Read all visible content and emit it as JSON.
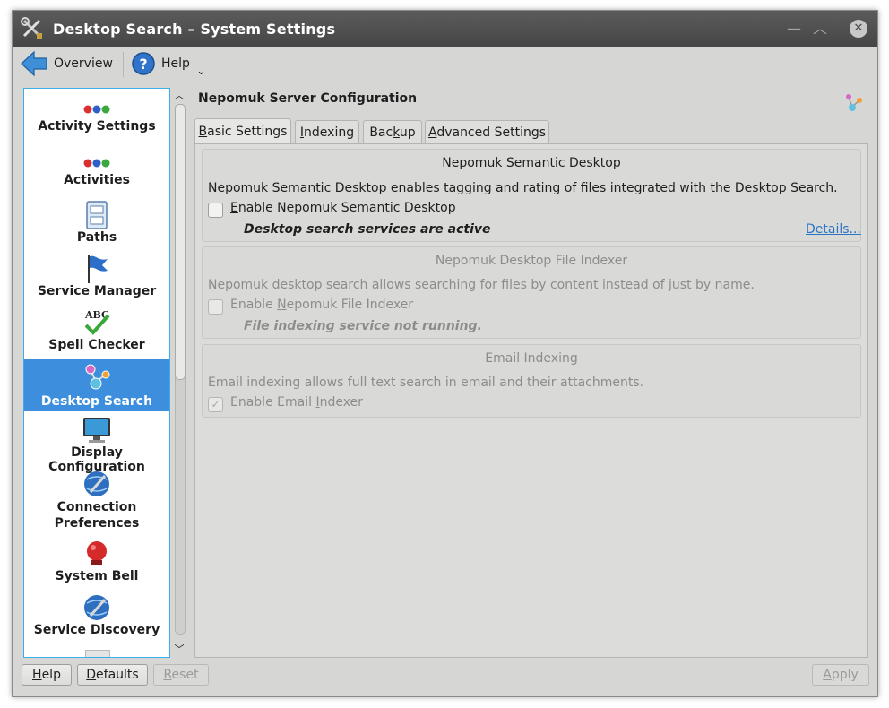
{
  "window": {
    "title": "Desktop Search – System Settings"
  },
  "toolbar": {
    "overview_label": "Overview",
    "help_label": "Help",
    "menu_arrow": "⌄"
  },
  "sidebar": {
    "items": [
      {
        "label": "Activity Settings",
        "icon": "three-dots-icon"
      },
      {
        "label": "Activities",
        "icon": "three-dots-icon"
      },
      {
        "label": "Paths",
        "icon": "drawer-icon"
      },
      {
        "label": "Service Manager",
        "icon": "flag-icon"
      },
      {
        "label": "Spell Checker",
        "icon": "abc-check-icon"
      },
      {
        "label": "Desktop Search",
        "icon": "molecule-icon",
        "selected": true
      },
      {
        "label": "Display Configuration",
        "icon": "monitor-icon"
      },
      {
        "label_line1": "Connection",
        "label_line2": "Preferences",
        "icon": "globe-wrench-icon"
      },
      {
        "label": "System Bell",
        "icon": "bell-icon"
      },
      {
        "label": "Service Discovery",
        "icon": "globe-wrench-icon"
      }
    ]
  },
  "main": {
    "heading": "Nepomuk Server Configuration",
    "tabs": [
      {
        "label_pre": "",
        "label_mn": "B",
        "label_post": "asic Settings",
        "active": true
      },
      {
        "label_pre": "",
        "label_mn": "I",
        "label_post": "ndexing"
      },
      {
        "label_pre": "Bac",
        "label_mn": "k",
        "label_post": "up"
      },
      {
        "label_pre": "",
        "label_mn": "A",
        "label_post": "dvanced Settings"
      }
    ],
    "groups": {
      "semantic": {
        "title": "Nepomuk Semantic Desktop",
        "description": "Nepomuk Semantic Desktop enables tagging and rating of files integrated with the Desktop Search.",
        "checkbox_label_mn": "E",
        "checkbox_label_post": "nable Nepomuk Semantic Desktop",
        "checked": false,
        "status": "Desktop search services are active",
        "details_link": "Details..."
      },
      "file_indexer": {
        "title": "Nepomuk Desktop File Indexer",
        "description": "Nepomuk desktop search allows searching for files by content instead of just by name.",
        "checkbox_label_pre": "Enable ",
        "checkbox_label_mn": "N",
        "checkbox_label_post": "epomuk File Indexer",
        "checked": false,
        "status": "File indexing service not running."
      },
      "email": {
        "title": "Email Indexing",
        "description": "Email indexing allows full text search in email and their attachments.",
        "checkbox_label_pre": "Enable Email ",
        "checkbox_label_mn": "I",
        "checkbox_label_post": "ndexer",
        "checked": true
      }
    }
  },
  "buttons": {
    "help": {
      "mn": "H",
      "post": "elp"
    },
    "defaults": {
      "mn": "D",
      "post": "efaults"
    },
    "reset": {
      "mn": "R",
      "post": "eset",
      "disabled": true
    },
    "apply": {
      "mn": "A",
      "post": "pply",
      "disabled": true
    }
  },
  "colors": {
    "selection": "#3d8fdd",
    "link": "#2a74c4",
    "titlebar": "#4f4f4f"
  }
}
